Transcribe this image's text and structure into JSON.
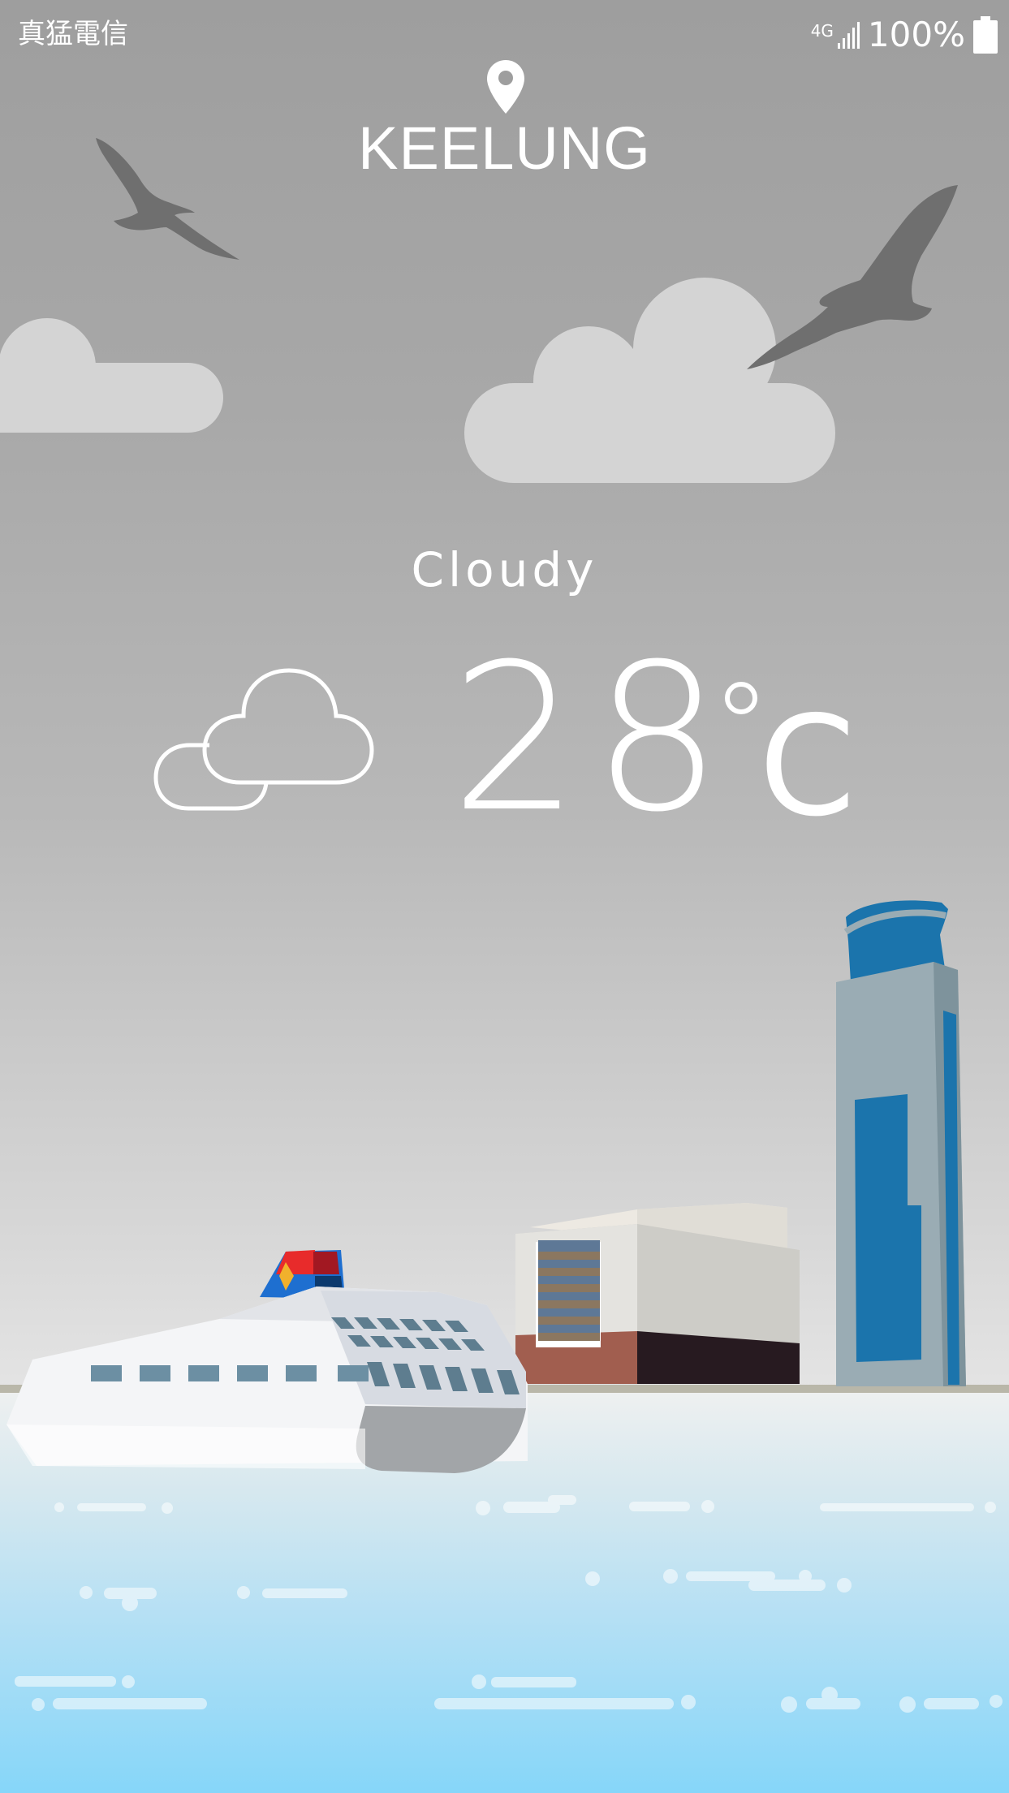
{
  "status_bar": {
    "carrier": "真猛電信",
    "network": "4G",
    "battery": "100%",
    "signal_icon": "signal-bars-icon",
    "battery_icon": "battery-full-icon"
  },
  "location": {
    "icon": "map-pin-icon",
    "city": "KEELUNG"
  },
  "weather": {
    "condition": "Cloudy",
    "condition_icon": "cloud-outline-icon",
    "temperature": "28",
    "unit": "C"
  },
  "colors": {
    "sky_top": "#9e9e9e",
    "sky_bottom": "#e4e4e4",
    "cloud": "#d4d4d4",
    "bird": "#6f6f6f",
    "tower_blue": "#1b74ac",
    "tower_gray": "#9aacb4",
    "sea_top": "#eef0f0",
    "sea_bottom": "#86d6f9",
    "ship_stripe_red": "#e82b2b",
    "ship_stripe_blue": "#1e6fd0"
  }
}
